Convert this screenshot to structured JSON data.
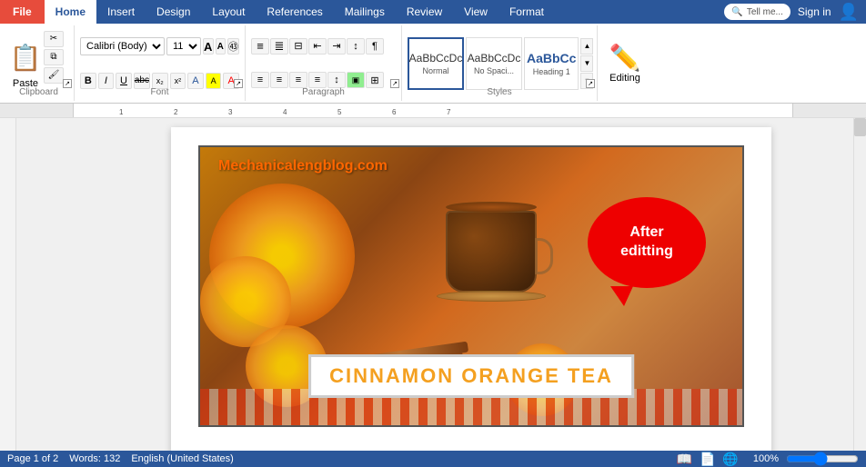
{
  "tabs": [
    {
      "label": "File",
      "id": "file",
      "active": false
    },
    {
      "label": "Home",
      "id": "home",
      "active": true
    },
    {
      "label": "Insert",
      "id": "insert",
      "active": false
    },
    {
      "label": "Design",
      "id": "design",
      "active": false
    },
    {
      "label": "Layout",
      "id": "layout",
      "active": false
    },
    {
      "label": "References",
      "id": "references",
      "active": false
    },
    {
      "label": "Mailings",
      "id": "mailings",
      "active": false
    },
    {
      "label": "Review",
      "id": "review",
      "active": false
    },
    {
      "label": "View",
      "id": "view",
      "active": false
    },
    {
      "label": "Format",
      "id": "format",
      "active": false
    }
  ],
  "header": {
    "tell_me": "Tell me...",
    "sign_in": "Sign in",
    "editing_label": "Editing"
  },
  "ribbon": {
    "clipboard": {
      "label": "Clipboard",
      "paste_label": "Paste",
      "cut_label": "✂",
      "copy_label": "⧉",
      "format_painter_label": "🖌"
    },
    "font": {
      "label": "Font",
      "name": "Calibri (Body)",
      "size": "11",
      "grow_label": "A",
      "shrink_label": "A",
      "clear_label": "A",
      "bold": "B",
      "italic": "I",
      "underline": "U",
      "strikethrough": "abc",
      "subscript": "x₂",
      "superscript": "x²",
      "highlight": "A",
      "color": "A"
    },
    "paragraph": {
      "label": "Paragraph",
      "bullets_label": "≡",
      "numbering_label": "≣",
      "multilevel_label": "⊟",
      "decrease_indent": "⇐",
      "increase_indent": "⇒",
      "sort_label": "↕",
      "show_marks": "¶",
      "align_left": "≡",
      "align_center": "≡",
      "align_right": "≡",
      "justify": "≡",
      "line_spacing": "↕",
      "shading": "▣",
      "borders": "⊞"
    },
    "styles": {
      "label": "Styles",
      "normal": "Normal",
      "no_spacing": "No Spaci...",
      "heading1": "Heading 1"
    },
    "editing": {
      "label": "Editing",
      "icon": "✏"
    }
  },
  "document": {
    "website_text": "Mechanicalengblog.com",
    "speech_bubble_text": "After\neditting",
    "title_text": "CINNAMON ORANGE TEA"
  },
  "status_bar": {
    "page": "Page 1 of 2",
    "words": "Words: 132",
    "language": "English (United States)"
  }
}
